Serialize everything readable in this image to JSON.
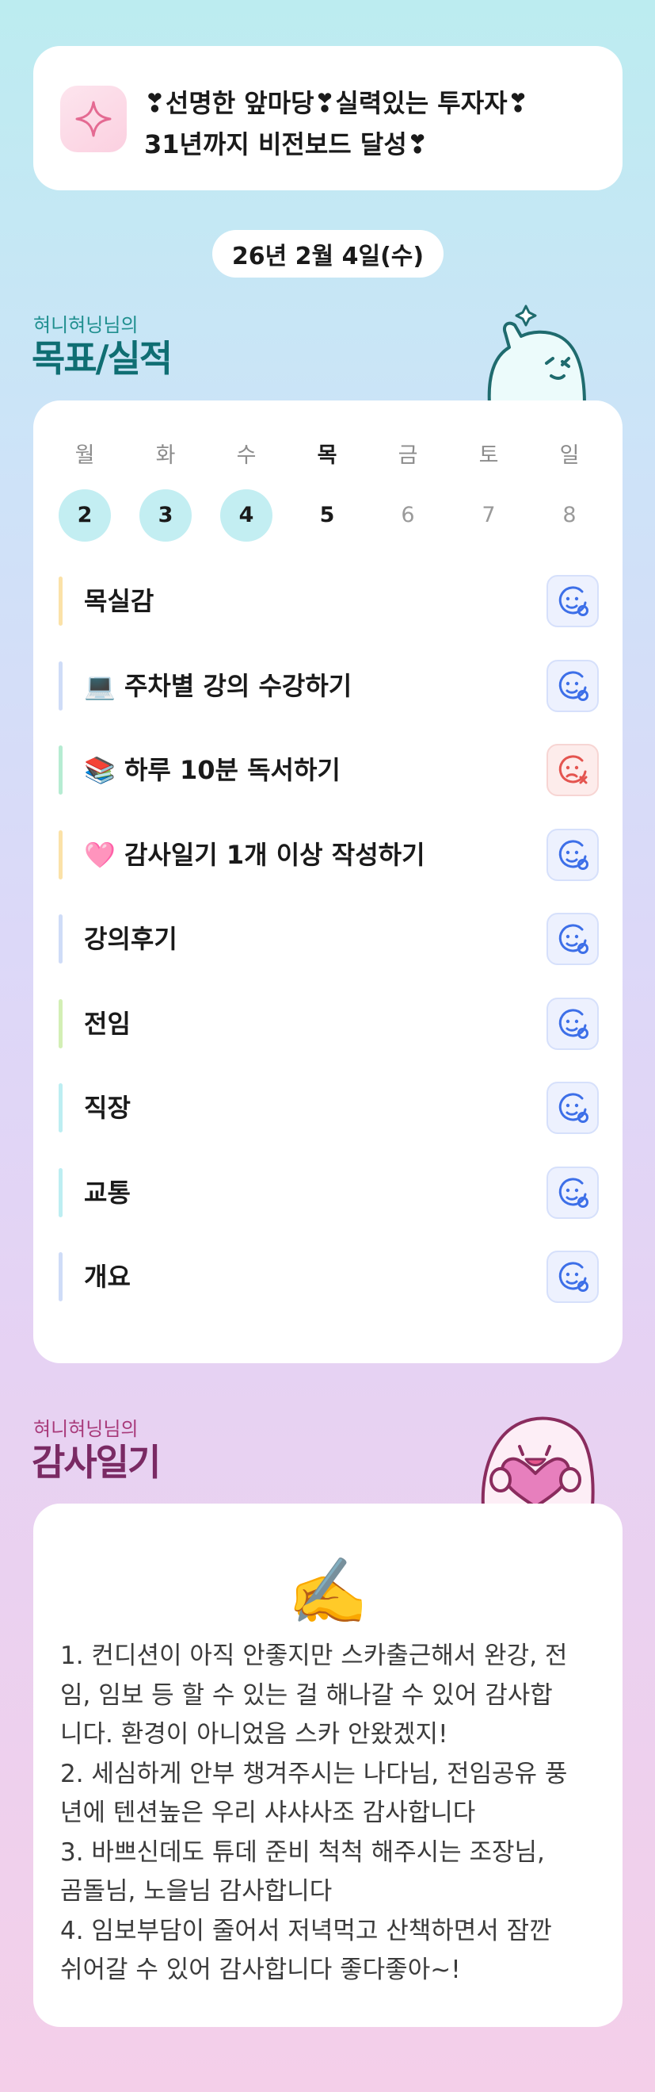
{
  "vision": {
    "line1": "❣선명한 앞마당❣실력있는 투자자❣",
    "line2": "31년까지 비전보드 달성❣",
    "icon": "sparkle-icon"
  },
  "date": "26년 2월 4일(수)",
  "goals_section": {
    "subtitle": "혀니혀닝님의",
    "title": "목표/실적"
  },
  "week": [
    {
      "day": "월",
      "num": "2",
      "state": "done"
    },
    {
      "day": "화",
      "num": "3",
      "state": "done"
    },
    {
      "day": "수",
      "num": "4",
      "state": "done"
    },
    {
      "day": "목",
      "num": "5",
      "state": "today"
    },
    {
      "day": "금",
      "num": "6",
      "state": "future"
    },
    {
      "day": "토",
      "num": "7",
      "state": "future"
    },
    {
      "day": "일",
      "num": "8",
      "state": "future"
    }
  ],
  "goals": [
    {
      "label": "목실감",
      "color": "#fbe2a8",
      "status": "ok"
    },
    {
      "label": "💻 주차별 강의 수강하기",
      "color": "#cfdcf7",
      "status": "ok"
    },
    {
      "label": "📚 하루 10분 독서하기",
      "color": "#b6ecd2",
      "status": "fail"
    },
    {
      "label": "🩷 감사일기 1개 이상 작성하기",
      "color": "#fbe2a8",
      "status": "ok"
    },
    {
      "label": "강의후기",
      "color": "#cfdcf7",
      "status": "ok"
    },
    {
      "label": "전임",
      "color": "#d3efb5",
      "status": "ok"
    },
    {
      "label": "직장",
      "color": "#bdeef2",
      "status": "ok"
    },
    {
      "label": "교통",
      "color": "#bdeef2",
      "status": "ok"
    },
    {
      "label": "개요",
      "color": "#cfdcf7",
      "status": "ok"
    }
  ],
  "thanks_section": {
    "subtitle": "혀니혀닝님의",
    "title": "감사일기",
    "emoji": "✍️",
    "lines": [
      "1. 컨디션이 아직 안좋지만 스카출근해서 완강, 전",
      "임, 임보 등 할 수 있는 걸 해나갈 수 있어 감사합",
      "니다. 환경이 아니었음 스카 안왔겠지!",
      "2. 세심하게 안부 챙겨주시는 나다님, 전임공유 풍",
      "년에 텐션높은 우리 샤샤사조 감사합니다",
      "3. 바쁘신데도 튜데 준비 척척 해주시는 조장님,",
      "곰돌님, 노을님 감사합니다",
      "4. 임보부담이 줄어서 저녁먹고 산책하면서 잠깐",
      "쉬어갈 수 있어 감사합니다 좋다좋아~!"
    ]
  },
  "colors": {
    "done_circle": "#c3eef2",
    "ok_icon": "#3d6fe8",
    "fail_icon": "#e4544f",
    "goals_title": "#0f6e73",
    "thanks_title": "#7a2a64"
  }
}
